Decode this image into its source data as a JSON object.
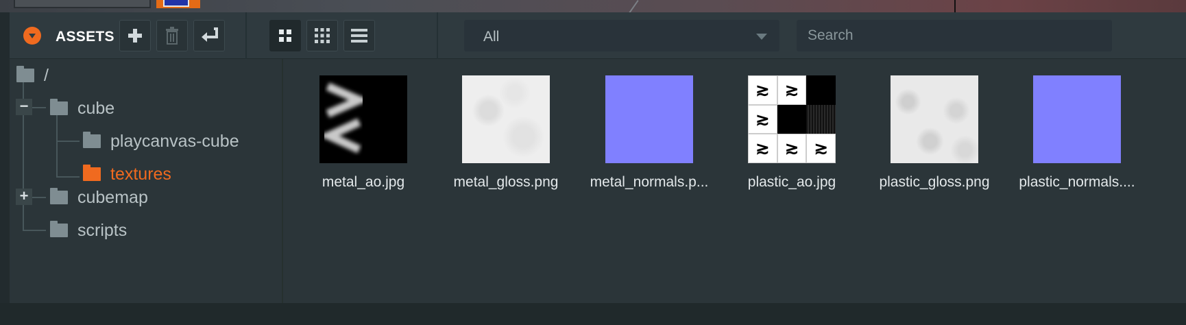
{
  "header": {
    "title": "ASSETS",
    "toolbar": {
      "add_icon": "plus-icon",
      "delete_icon": "trash-icon",
      "back_icon": "return-arrow-icon"
    },
    "view_modes": {
      "large_grid_icon": "grid-large-icon",
      "small_grid_icon": "grid-small-icon",
      "list_icon": "list-icon",
      "active": "large-grid"
    },
    "filter": {
      "selected": "All"
    },
    "search": {
      "placeholder": "Search",
      "value": ""
    }
  },
  "tree": {
    "root": "/",
    "items": [
      {
        "label": "cube",
        "expanded": true,
        "toggle": "−"
      },
      {
        "label": "playcanvas-cube"
      },
      {
        "label": "textures",
        "selected": true
      },
      {
        "label": "cubemap",
        "expanded": false,
        "toggle": "+"
      },
      {
        "label": "scripts"
      }
    ]
  },
  "assets": [
    {
      "name": "metal_ao.jpg"
    },
    {
      "name": "metal_gloss.png"
    },
    {
      "name": "metal_normals.p..."
    },
    {
      "name": "plastic_ao.jpg"
    },
    {
      "name": "plastic_gloss.png"
    },
    {
      "name": "plastic_normals...."
    }
  ],
  "colors": {
    "accent": "#f06a1f",
    "panel": "#2b3539",
    "header": "#2f3a3f",
    "normal_map": "#8080ff"
  }
}
